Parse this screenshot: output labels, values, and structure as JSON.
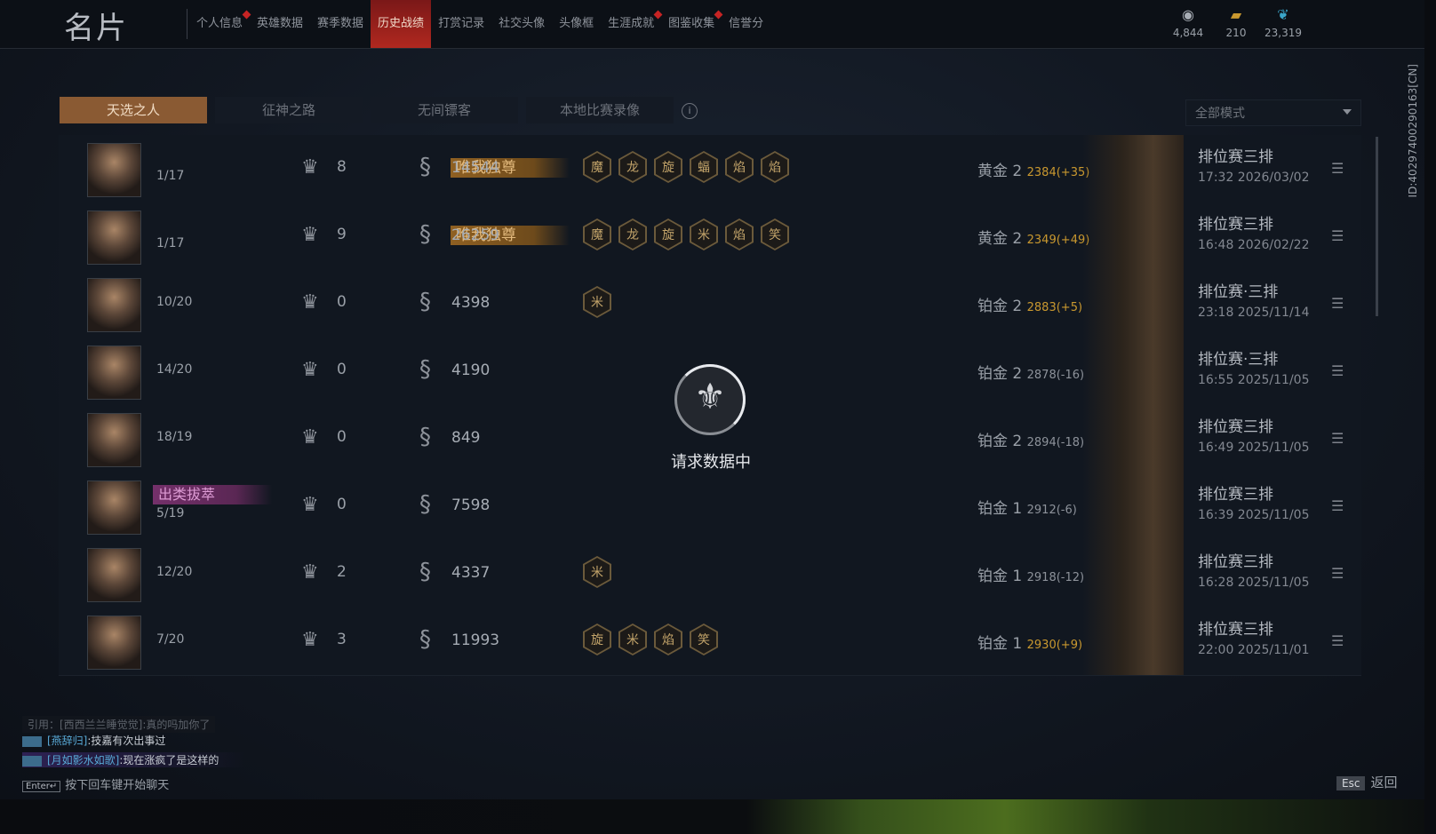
{
  "header": {
    "title": "名片",
    "nav": [
      {
        "label": "个人信息",
        "dot": true
      },
      {
        "label": "英雄数据",
        "dot": false
      },
      {
        "label": "赛季数据",
        "dot": false
      },
      {
        "label": "历史战绩",
        "dot": false,
        "active": true
      },
      {
        "label": "打赏记录",
        "dot": false
      },
      {
        "label": "社交头像",
        "dot": false
      },
      {
        "label": "头像框",
        "dot": false
      },
      {
        "label": "生涯成就",
        "dot": true
      },
      {
        "label": "图鉴收集",
        "dot": true
      },
      {
        "label": "信誉分",
        "dot": false
      }
    ],
    "currencies": [
      {
        "icon": "eye-coin-icon",
        "value": "4,844"
      },
      {
        "icon": "gold-bars-icon",
        "value": "210"
      },
      {
        "icon": "feather-icon",
        "value": "23,319"
      }
    ]
  },
  "tabs": [
    "天选之人",
    "征神之路",
    "无间镖客",
    "本地比赛录像"
  ],
  "filter": {
    "selected": "全部模式"
  },
  "uid": "ID:402974002901​63[CN]",
  "loading": {
    "text": "请求数据中"
  },
  "rows": [
    {
      "badge": "唯我独尊",
      "badge_style": "gold",
      "rank": "1/17",
      "kills": "8",
      "gold": "14544",
      "icons": [
        "魔",
        "龙",
        "旋",
        "蝠",
        "焰",
        "焰"
      ],
      "tier": "黄金 2",
      "score": "2384(+35)",
      "mode": "排位赛三排",
      "time": "17:32  2026/03/02"
    },
    {
      "badge": "唯我独尊",
      "badge_style": "gold",
      "rank": "1/17",
      "kills": "9",
      "gold": "26259",
      "icons": [
        "魔",
        "龙",
        "旋",
        "米",
        "焰",
        "笑"
      ],
      "tier": "黄金 2",
      "score": "2349(+49)",
      "mode": "排位赛三排",
      "time": "16:48  2026/02/22"
    },
    {
      "badge": "",
      "badge_style": "",
      "rank": "10/20",
      "kills": "0",
      "gold": "4398",
      "icons": [
        "米"
      ],
      "tier": "铂金 2",
      "score": "2883(+5)",
      "mode": "排位赛·三排",
      "time": "23:18  2025/11/14"
    },
    {
      "badge": "",
      "badge_style": "",
      "rank": "14/20",
      "kills": "0",
      "gold": "4190",
      "icons": [],
      "tier": "铂金 2",
      "score": "2878(-16)",
      "mode": "排位赛·三排",
      "time": "16:55  2025/11/05"
    },
    {
      "badge": "",
      "badge_style": "",
      "rank": "18/19",
      "kills": "0",
      "gold": "849",
      "icons": [],
      "tier": "铂金 2",
      "score": "2894(-18)",
      "mode": "排位赛三排",
      "time": "16:49  2025/11/05"
    },
    {
      "badge": "出类拔萃",
      "badge_style": "purple",
      "rank": "5/19",
      "kills": "0",
      "gold": "7598",
      "icons": [],
      "tier": "铂金 1",
      "score": "2912(-6)",
      "mode": "排位赛三排",
      "time": "16:39  2025/11/05"
    },
    {
      "badge": "",
      "badge_style": "",
      "rank": "12/20",
      "kills": "2",
      "gold": "4337",
      "icons": [
        "米"
      ],
      "tier": "铂金 1",
      "score": "2918(-12)",
      "mode": "排位赛三排",
      "time": "16:28  2025/11/05"
    },
    {
      "badge": "",
      "badge_style": "",
      "rank": "7/20",
      "kills": "3",
      "gold": "11993",
      "icons": [
        "旋",
        "米",
        "焰",
        "笑"
      ],
      "tier": "铂金 1",
      "score": "2930(+9)",
      "mode": "排位赛三排",
      "time": "22:00  2025/11/01"
    }
  ],
  "chat": {
    "quote": "引用：[西西兰兰睡觉觉]:真的吗加你了",
    "line1_name": "[燕辞归]",
    "line1_text": ":技嘉有次出事过",
    "line2_name": "[月如影水如歌]",
    "line2_text": ":现在涨疯了是这样的",
    "enter_key": "Enter↵",
    "enter_hint": "按下回车键开始聊天"
  },
  "footer": {
    "esc_key": "Esc",
    "back_label": "返回"
  }
}
